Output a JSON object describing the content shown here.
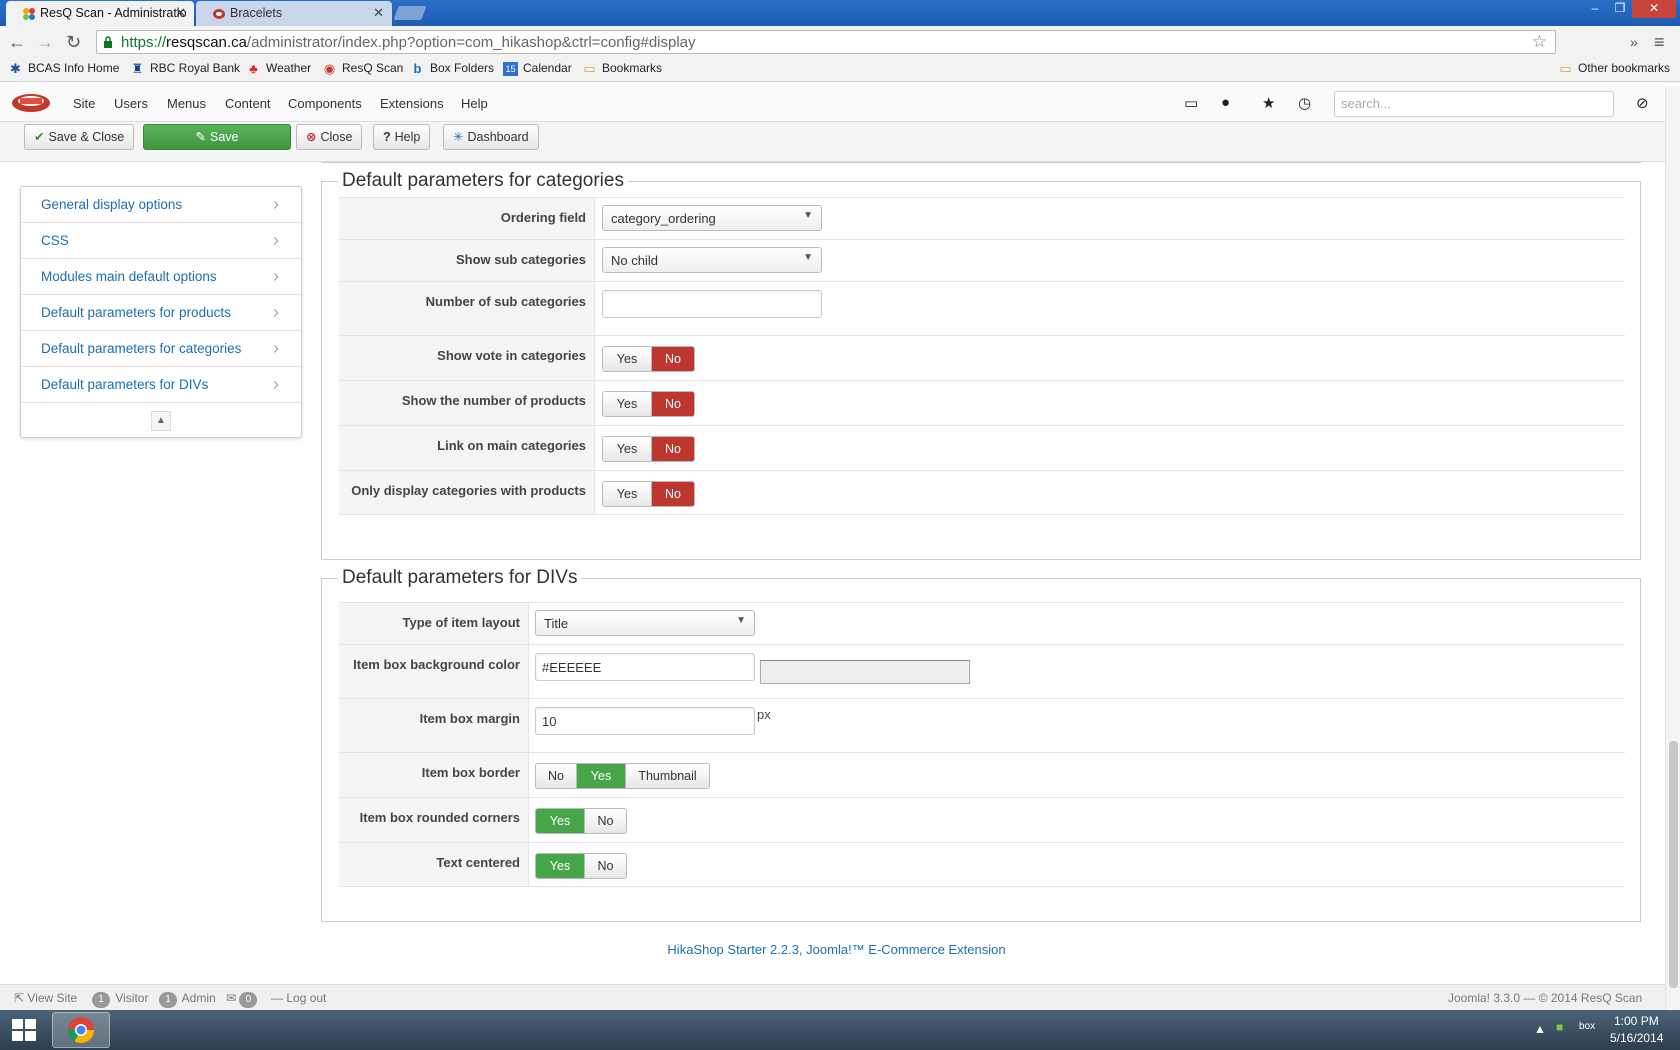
{
  "browser": {
    "tabs": [
      {
        "title": "ResQ Scan - Administratio",
        "active": true
      },
      {
        "title": "Bracelets",
        "active": false
      }
    ],
    "url_scheme": "https://",
    "url_host": "resqscan.ca",
    "url_path": "/administrator/index.php?option=com_hikashop&ctrl=config#display",
    "bookmarks": [
      "BCAS Info Home",
      "RBC Royal Bank",
      "Weather",
      "ResQ Scan",
      "Box Folders",
      "Calendar",
      "Bookmarks"
    ],
    "other_bookmarks": "Other bookmarks"
  },
  "admin_menu": {
    "items": [
      "Site",
      "Users",
      "Menus",
      "Content",
      "Components",
      "Extensions",
      "Help"
    ],
    "search_placeholder": "search..."
  },
  "toolbar": {
    "save_close": "Save & Close",
    "save": "Save",
    "close": "Close",
    "help": "Help",
    "dashboard": "Dashboard"
  },
  "sidebar": {
    "items": [
      "General display options",
      "CSS",
      "Modules main default options",
      "Default parameters for products",
      "Default parameters for categories",
      "Default parameters for DIVs"
    ]
  },
  "categories": {
    "legend": "Default parameters for categories",
    "ordering_field_label": "Ordering field",
    "ordering_field_value": "category_ordering",
    "show_sub_label": "Show sub categories",
    "show_sub_value": "No child",
    "num_sub_label": "Number of sub categories",
    "num_sub_value": "",
    "show_vote_label": "Show vote in categories",
    "show_number_label": "Show the number of products",
    "link_main_label": "Link on main categories",
    "only_display_label": "Only display categories with products",
    "yes": "Yes",
    "no": "No"
  },
  "divs": {
    "legend": "Default parameters for DIVs",
    "layout_label": "Type of item layout",
    "layout_value": "Title",
    "bg_label": "Item box background color",
    "bg_value": "#EEEEEE",
    "margin_label": "Item box margin",
    "margin_value": "10",
    "margin_unit": "px",
    "border_label": "Item box border",
    "border_options": [
      "No",
      "Yes",
      "Thumbnail"
    ],
    "rounded_label": "Item box rounded corners",
    "centered_label": "Text centered",
    "yes": "Yes",
    "no": "No"
  },
  "footer": {
    "credit": "HikaShop Starter 2.2.3, Joomla!™ E-Commerce Extension"
  },
  "status": {
    "view_site": "View Site",
    "visitor_count": "1",
    "visitor_label": "Visitor",
    "admin_count": "1",
    "admin_label": "Admin",
    "msg_count": "0",
    "logout": "Log out",
    "version": "Joomla! 3.3.0 — © 2014 ResQ Scan"
  },
  "taskbar": {
    "time": "1:00 PM",
    "date": "5/16/2014"
  },
  "colors": {
    "accent_red": "#bd362f",
    "accent_green": "#46a546",
    "link_blue": "#1a6fb5",
    "swatch": "#EEEEEE"
  }
}
